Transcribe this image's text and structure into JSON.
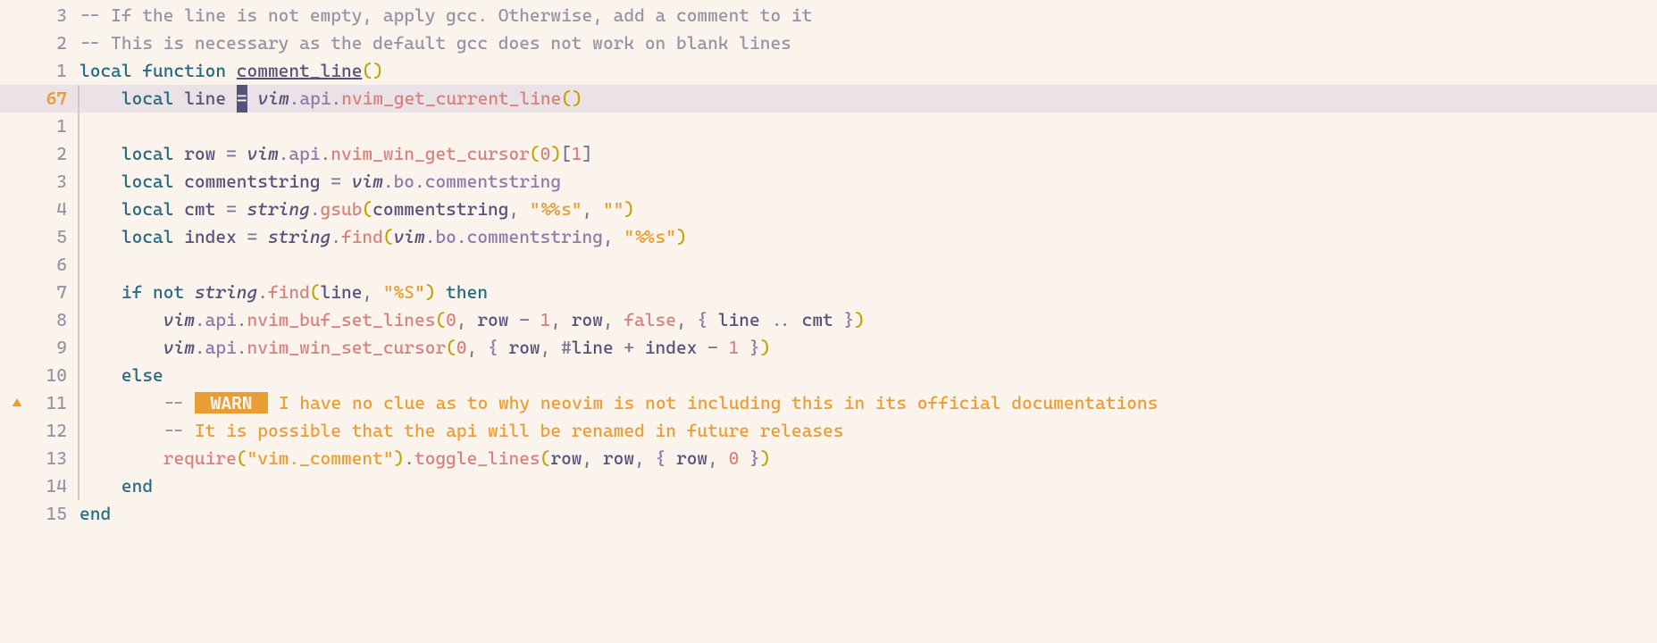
{
  "currentLineAbs": "67",
  "lines": [
    {
      "rel": "3",
      "segs": [
        {
          "cls": "c-comment",
          "t": "-- If the line is not empty, apply gcc. Otherwise, add a comment to it"
        }
      ]
    },
    {
      "rel": "2",
      "segs": [
        {
          "cls": "c-comment",
          "t": "-- This is necessary as the default gcc does not work on blank lines"
        }
      ]
    },
    {
      "rel": "1",
      "segs": [
        {
          "cls": "c-kw",
          "t": "local"
        },
        {
          "t": " "
        },
        {
          "cls": "c-kw",
          "t": "function"
        },
        {
          "t": " "
        },
        {
          "cls": "c-def",
          "t": "comment_line"
        },
        {
          "cls": "c-paren1",
          "t": "()"
        }
      ]
    },
    {
      "rel": "67",
      "curr": true,
      "hl": true,
      "indent": 1,
      "segs": [
        {
          "cls": "c-kw",
          "t": "local"
        },
        {
          "t": " "
        },
        {
          "cls": "c-ident",
          "t": "line"
        },
        {
          "t": " "
        },
        {
          "cursor": true,
          "t": "="
        },
        {
          "t": " "
        },
        {
          "cls": "c-var",
          "t": "vim"
        },
        {
          "cls": "c-op",
          "t": "."
        },
        {
          "cls": "c-field",
          "t": "api"
        },
        {
          "cls": "c-op",
          "t": "."
        },
        {
          "cls": "c-call",
          "t": "nvim_get_current_line"
        },
        {
          "cls": "c-paren1",
          "t": "()"
        }
      ]
    },
    {
      "rel": "1",
      "indent": 0,
      "segs": []
    },
    {
      "rel": "2",
      "indent": 1,
      "segs": [
        {
          "cls": "c-kw",
          "t": "local"
        },
        {
          "t": " "
        },
        {
          "cls": "c-ident",
          "t": "row"
        },
        {
          "t": " "
        },
        {
          "cls": "c-op",
          "t": "="
        },
        {
          "t": " "
        },
        {
          "cls": "c-var",
          "t": "vim"
        },
        {
          "cls": "c-op",
          "t": "."
        },
        {
          "cls": "c-field",
          "t": "api"
        },
        {
          "cls": "c-op",
          "t": "."
        },
        {
          "cls": "c-call",
          "t": "nvim_win_get_cursor"
        },
        {
          "cls": "c-paren1",
          "t": "("
        },
        {
          "cls": "c-num",
          "t": "0"
        },
        {
          "cls": "c-paren1",
          "t": ")"
        },
        {
          "cls": "c-index",
          "t": "["
        },
        {
          "cls": "c-num",
          "t": "1"
        },
        {
          "cls": "c-index",
          "t": "]"
        }
      ]
    },
    {
      "rel": "3",
      "indent": 1,
      "segs": [
        {
          "cls": "c-kw",
          "t": "local"
        },
        {
          "t": " "
        },
        {
          "cls": "c-ident",
          "t": "commentstring"
        },
        {
          "t": " "
        },
        {
          "cls": "c-op",
          "t": "="
        },
        {
          "t": " "
        },
        {
          "cls": "c-var",
          "t": "vim"
        },
        {
          "cls": "c-op",
          "t": "."
        },
        {
          "cls": "c-field",
          "t": "bo"
        },
        {
          "cls": "c-op",
          "t": "."
        },
        {
          "cls": "c-field",
          "t": "commentstring"
        }
      ]
    },
    {
      "rel": "4",
      "indent": 1,
      "segs": [
        {
          "cls": "c-kw",
          "t": "local"
        },
        {
          "t": " "
        },
        {
          "cls": "c-ident",
          "t": "cmt"
        },
        {
          "t": " "
        },
        {
          "cls": "c-op",
          "t": "="
        },
        {
          "t": " "
        },
        {
          "cls": "c-var",
          "t": "string"
        },
        {
          "cls": "c-op",
          "t": "."
        },
        {
          "cls": "c-call",
          "t": "gsub"
        },
        {
          "cls": "c-paren1",
          "t": "("
        },
        {
          "cls": "c-ident",
          "t": "commentstring"
        },
        {
          "cls": "c-op",
          "t": ","
        },
        {
          "t": " "
        },
        {
          "cls": "c-str",
          "t": "\"%%s\""
        },
        {
          "cls": "c-op",
          "t": ","
        },
        {
          "t": " "
        },
        {
          "cls": "c-str",
          "t": "\"\""
        },
        {
          "cls": "c-paren1",
          "t": ")"
        }
      ]
    },
    {
      "rel": "5",
      "indent": 1,
      "segs": [
        {
          "cls": "c-kw",
          "t": "local"
        },
        {
          "t": " "
        },
        {
          "cls": "c-ident",
          "t": "index"
        },
        {
          "t": " "
        },
        {
          "cls": "c-op",
          "t": "="
        },
        {
          "t": " "
        },
        {
          "cls": "c-var",
          "t": "string"
        },
        {
          "cls": "c-op",
          "t": "."
        },
        {
          "cls": "c-call",
          "t": "find"
        },
        {
          "cls": "c-paren1",
          "t": "("
        },
        {
          "cls": "c-var",
          "t": "vim"
        },
        {
          "cls": "c-op",
          "t": "."
        },
        {
          "cls": "c-field",
          "t": "bo"
        },
        {
          "cls": "c-op",
          "t": "."
        },
        {
          "cls": "c-field",
          "t": "commentstring"
        },
        {
          "cls": "c-op",
          "t": ","
        },
        {
          "t": " "
        },
        {
          "cls": "c-str",
          "t": "\"%%s\""
        },
        {
          "cls": "c-paren1",
          "t": ")"
        }
      ]
    },
    {
      "rel": "6",
      "indent": 0,
      "segs": []
    },
    {
      "rel": "7",
      "indent": 1,
      "segs": [
        {
          "cls": "c-kw",
          "t": "if"
        },
        {
          "t": " "
        },
        {
          "cls": "c-kw",
          "t": "not"
        },
        {
          "t": " "
        },
        {
          "cls": "c-var",
          "t": "string"
        },
        {
          "cls": "c-op",
          "t": "."
        },
        {
          "cls": "c-call",
          "t": "find"
        },
        {
          "cls": "c-paren1",
          "t": "("
        },
        {
          "cls": "c-ident",
          "t": "line"
        },
        {
          "cls": "c-op",
          "t": ","
        },
        {
          "t": " "
        },
        {
          "cls": "c-str",
          "t": "\"%S\""
        },
        {
          "cls": "c-paren1",
          "t": ")"
        },
        {
          "t": " "
        },
        {
          "cls": "c-kw",
          "t": "then"
        }
      ]
    },
    {
      "rel": "8",
      "change": true,
      "indent": 2,
      "segs": [
        {
          "cls": "c-var",
          "t": "vim"
        },
        {
          "cls": "c-op",
          "t": "."
        },
        {
          "cls": "c-field",
          "t": "api"
        },
        {
          "cls": "c-op",
          "t": "."
        },
        {
          "cls": "c-call",
          "t": "nvim_buf_set_lines"
        },
        {
          "cls": "c-paren1",
          "t": "("
        },
        {
          "cls": "c-num",
          "t": "0"
        },
        {
          "cls": "c-op",
          "t": ","
        },
        {
          "t": " "
        },
        {
          "cls": "c-ident",
          "t": "row"
        },
        {
          "t": " "
        },
        {
          "cls": "c-op",
          "t": "-"
        },
        {
          "t": " "
        },
        {
          "cls": "c-num",
          "t": "1"
        },
        {
          "cls": "c-op",
          "t": ","
        },
        {
          "t": " "
        },
        {
          "cls": "c-ident",
          "t": "row"
        },
        {
          "cls": "c-op",
          "t": ","
        },
        {
          "t": " "
        },
        {
          "cls": "c-bool",
          "t": "false"
        },
        {
          "cls": "c-op",
          "t": ","
        },
        {
          "t": " "
        },
        {
          "cls": "c-paren2",
          "t": "{"
        },
        {
          "t": " "
        },
        {
          "cls": "c-ident",
          "t": "line"
        },
        {
          "t": " "
        },
        {
          "cls": "c-op",
          "t": ".."
        },
        {
          "t": " "
        },
        {
          "cls": "c-ident",
          "t": "cmt"
        },
        {
          "t": " "
        },
        {
          "cls": "c-paren2",
          "t": "}"
        },
        {
          "cls": "c-paren1",
          "t": ")"
        }
      ]
    },
    {
      "rel": "9",
      "change": true,
      "indent": 2,
      "segs": [
        {
          "cls": "c-var",
          "t": "vim"
        },
        {
          "cls": "c-op",
          "t": "."
        },
        {
          "cls": "c-field",
          "t": "api"
        },
        {
          "cls": "c-op",
          "t": "."
        },
        {
          "cls": "c-call",
          "t": "nvim_win_set_cursor"
        },
        {
          "cls": "c-paren1",
          "t": "("
        },
        {
          "cls": "c-num",
          "t": "0"
        },
        {
          "cls": "c-op",
          "t": ","
        },
        {
          "t": " "
        },
        {
          "cls": "c-paren2",
          "t": "{"
        },
        {
          "t": " "
        },
        {
          "cls": "c-ident",
          "t": "row"
        },
        {
          "cls": "c-op",
          "t": ","
        },
        {
          "t": " "
        },
        {
          "cls": "c-op",
          "t": "#"
        },
        {
          "cls": "c-ident",
          "t": "line"
        },
        {
          "t": " "
        },
        {
          "cls": "c-op",
          "t": "+"
        },
        {
          "t": " "
        },
        {
          "cls": "c-ident",
          "t": "index"
        },
        {
          "t": " "
        },
        {
          "cls": "c-op",
          "t": "-"
        },
        {
          "t": " "
        },
        {
          "cls": "c-num",
          "t": "1"
        },
        {
          "t": " "
        },
        {
          "cls": "c-paren2",
          "t": "}"
        },
        {
          "cls": "c-paren1",
          "t": ")"
        }
      ]
    },
    {
      "rel": "10",
      "indent": 1,
      "segs": [
        {
          "cls": "c-kw",
          "t": "else"
        }
      ]
    },
    {
      "rel": "11",
      "sign": "warn",
      "indent": 2,
      "segs": [
        {
          "cls": "c-comment",
          "t": "-- "
        },
        {
          "badge": true,
          "t": " WARN "
        },
        {
          "cls": "c-todo",
          "t": " I have no clue as to why neovim is not including this in its official documentations"
        }
      ]
    },
    {
      "rel": "12",
      "indent": 2,
      "segs": [
        {
          "cls": "c-comment",
          "t": "-- "
        },
        {
          "cls": "c-todo",
          "t": "It is possible that the api will be renamed in future releases"
        }
      ]
    },
    {
      "rel": "13",
      "indent": 2,
      "segs": [
        {
          "cls": "c-call",
          "t": "require"
        },
        {
          "cls": "c-paren1",
          "t": "("
        },
        {
          "cls": "c-str",
          "t": "\"vim._comment\""
        },
        {
          "cls": "c-paren1",
          "t": ")"
        },
        {
          "cls": "c-op",
          "t": "."
        },
        {
          "cls": "c-call",
          "t": "toggle_lines"
        },
        {
          "cls": "c-paren1",
          "t": "("
        },
        {
          "cls": "c-ident",
          "t": "row"
        },
        {
          "cls": "c-op",
          "t": ","
        },
        {
          "t": " "
        },
        {
          "cls": "c-ident",
          "t": "row"
        },
        {
          "cls": "c-op",
          "t": ","
        },
        {
          "t": " "
        },
        {
          "cls": "c-paren2",
          "t": "{"
        },
        {
          "t": " "
        },
        {
          "cls": "c-ident",
          "t": "row"
        },
        {
          "cls": "c-op",
          "t": ","
        },
        {
          "t": " "
        },
        {
          "cls": "c-num",
          "t": "0"
        },
        {
          "t": " "
        },
        {
          "cls": "c-paren2",
          "t": "}"
        },
        {
          "cls": "c-paren1",
          "t": ")"
        }
      ]
    },
    {
      "rel": "14",
      "indent": 1,
      "segs": [
        {
          "cls": "c-kw",
          "t": "end"
        }
      ]
    },
    {
      "rel": "15",
      "noRule": true,
      "segs": [
        {
          "cls": "c-kw",
          "t": "end"
        }
      ]
    }
  ],
  "icons": {
    "warn": "▲"
  }
}
